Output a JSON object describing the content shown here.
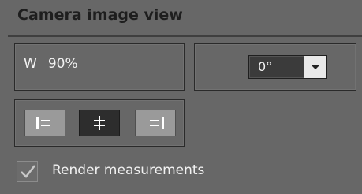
{
  "panel": {
    "title": "Camera image view"
  },
  "zoom": {
    "axis_label": "W",
    "value": "90%"
  },
  "rotation": {
    "selected": "0°"
  },
  "alignment": {
    "buttons": [
      {
        "icon": "align-left-icon",
        "active": false
      },
      {
        "icon": "align-center-icon",
        "active": true
      },
      {
        "icon": "align-right-icon",
        "active": false
      }
    ]
  },
  "render_measurements": {
    "label": "Render measurements",
    "checked": true
  },
  "colors": {
    "background": "#676767",
    "active_button": "#2d2d2d",
    "inactive_button": "#9a9a9a"
  }
}
